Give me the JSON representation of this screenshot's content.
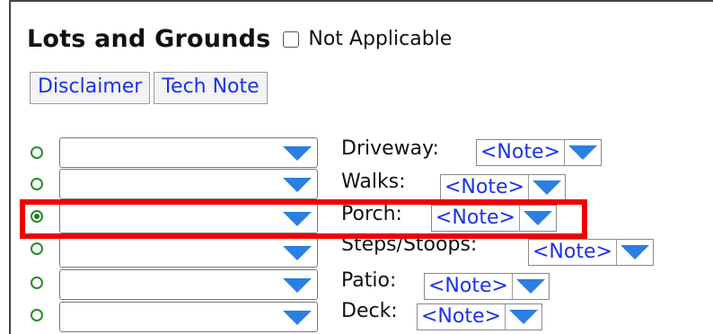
{
  "section": {
    "title": "Lots and Grounds",
    "not_applicable_label": "Not Applicable"
  },
  "buttons": {
    "disclaimer": "Disclaimer",
    "tech_note": "Tech Note"
  },
  "items": [
    {
      "label": "Driveway:",
      "note": "<Note>",
      "selected": false
    },
    {
      "label": "Walks:",
      "note": "<Note>",
      "selected": false
    },
    {
      "label": "Porch:",
      "note": "<Note>",
      "selected": true
    },
    {
      "label": "Steps/Stoops:",
      "note": "<Note>",
      "selected": false
    },
    {
      "label": "Patio:",
      "note": "<Note>",
      "selected": false
    },
    {
      "label": "Deck:",
      "note": "<Note>",
      "selected": false
    }
  ],
  "colors": {
    "link_blue": "#1a33e6",
    "arrow_blue": "#2a7fe0",
    "radio_green": "#2a8a2a",
    "highlight_red": "#ee0000"
  }
}
